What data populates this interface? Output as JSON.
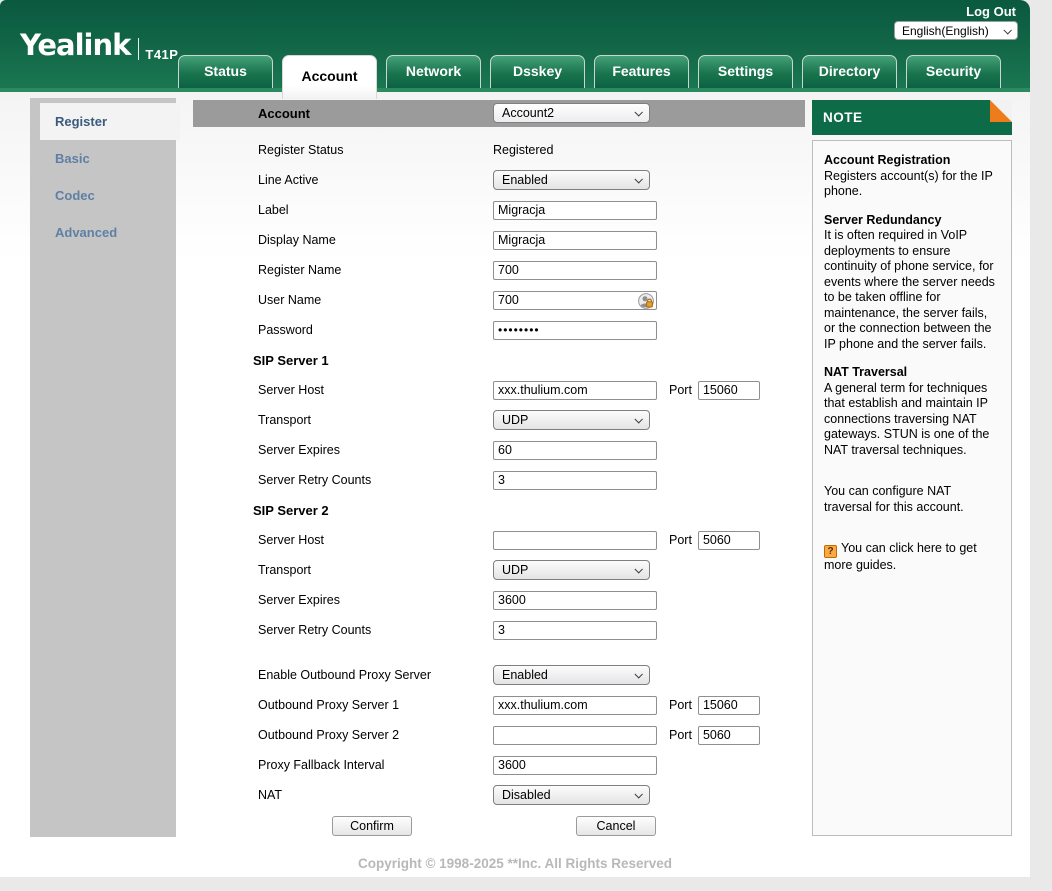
{
  "header": {
    "logout_label": "Log Out",
    "brand": "Yealink",
    "model": "T41P",
    "language": "English(English)",
    "tabs": [
      {
        "label": "Status",
        "active": false
      },
      {
        "label": "Account",
        "active": true
      },
      {
        "label": "Network",
        "active": false
      },
      {
        "label": "Dsskey",
        "active": false
      },
      {
        "label": "Features",
        "active": false
      },
      {
        "label": "Settings",
        "active": false
      },
      {
        "label": "Directory",
        "active": false
      },
      {
        "label": "Security",
        "active": false
      }
    ]
  },
  "sidebar": {
    "items": [
      {
        "label": "Register",
        "active": true
      },
      {
        "label": "Basic",
        "active": false
      },
      {
        "label": "Codec",
        "active": false
      },
      {
        "label": "Advanced",
        "active": false
      }
    ]
  },
  "form": {
    "account_bar": {
      "label": "Account",
      "value": "Account2"
    },
    "rows": [
      {
        "type": "static",
        "label": "Register Status",
        "value": "Registered"
      },
      {
        "type": "select",
        "label": "Line Active",
        "value": "Enabled"
      },
      {
        "type": "input",
        "label": "Label",
        "value": "Migracja"
      },
      {
        "type": "input",
        "label": "Display Name",
        "value": "Migracja"
      },
      {
        "type": "input",
        "label": "Register Name",
        "value": "700"
      },
      {
        "type": "input",
        "label": "User Name",
        "value": "700",
        "icon": "credential-lock-icon"
      },
      {
        "type": "password",
        "label": "Password",
        "value": "••••••••"
      },
      {
        "type": "section",
        "label": "SIP Server 1"
      },
      {
        "type": "input_port",
        "label": "Server Host",
        "value": "xxx.thulium.com",
        "port_label": "Port",
        "port_value": "15060"
      },
      {
        "type": "select",
        "label": "Transport",
        "value": "UDP"
      },
      {
        "type": "input",
        "label": "Server Expires",
        "value": "60"
      },
      {
        "type": "input",
        "label": "Server Retry Counts",
        "value": "3"
      },
      {
        "type": "section",
        "label": "SIP Server 2"
      },
      {
        "type": "input_port",
        "label": "Server Host",
        "value": "",
        "port_label": "Port",
        "port_value": "5060"
      },
      {
        "type": "select",
        "label": "Transport",
        "value": "UDP"
      },
      {
        "type": "input",
        "label": "Server Expires",
        "value": "3600"
      },
      {
        "type": "input",
        "label": "Server Retry Counts",
        "value": "3"
      },
      {
        "type": "spacer"
      },
      {
        "type": "select",
        "label": "Enable Outbound Proxy Server",
        "value": "Enabled"
      },
      {
        "type": "input_port",
        "label": "Outbound Proxy Server 1",
        "value": "xxx.thulium.com",
        "port_label": "Port",
        "port_value": "15060"
      },
      {
        "type": "input_port",
        "label": "Outbound Proxy Server 2",
        "value": "",
        "port_label": "Port",
        "port_value": "5060"
      },
      {
        "type": "input",
        "label": "Proxy Fallback Interval",
        "value": "3600"
      },
      {
        "type": "select",
        "label": "NAT",
        "value": "Disabled"
      }
    ],
    "buttons": {
      "confirm": "Confirm",
      "cancel": "Cancel"
    }
  },
  "note": {
    "title": "NOTE",
    "sections": [
      {
        "title": "Account Registration",
        "body": "Registers account(s) for the IP phone."
      },
      {
        "title": "Server Redundancy",
        "body": "It is often required in VoIP deployments to ensure continuity of phone service, for events where the server needs to be taken offline for maintenance, the server fails, or the connection between the IP phone and the server fails."
      },
      {
        "title": "NAT Traversal",
        "body": "A general term for techniques that establish and maintain IP connections traversing NAT gateways. STUN is one of the NAT traversal techniques."
      },
      {
        "title": "",
        "body": "You can configure NAT traversal for this account."
      },
      {
        "title": "",
        "body": "You can click here to get more guides.",
        "icon": "help-icon"
      }
    ]
  },
  "footer": {
    "copyright": "Copyright © 1998-2025 **Inc. All Rights Reserved"
  },
  "colors": {
    "header_green": "#0d6646",
    "band_green": "#2c8a60",
    "note_green": "#0e6b47",
    "fold_orange": "#ef7c1b",
    "sidebar_gray": "#c5c5c5",
    "account_bar_gray": "#9b9b9b",
    "sidebar_link_blue": "#5f7fa5",
    "copyright_gray": "#b8b8b8"
  }
}
